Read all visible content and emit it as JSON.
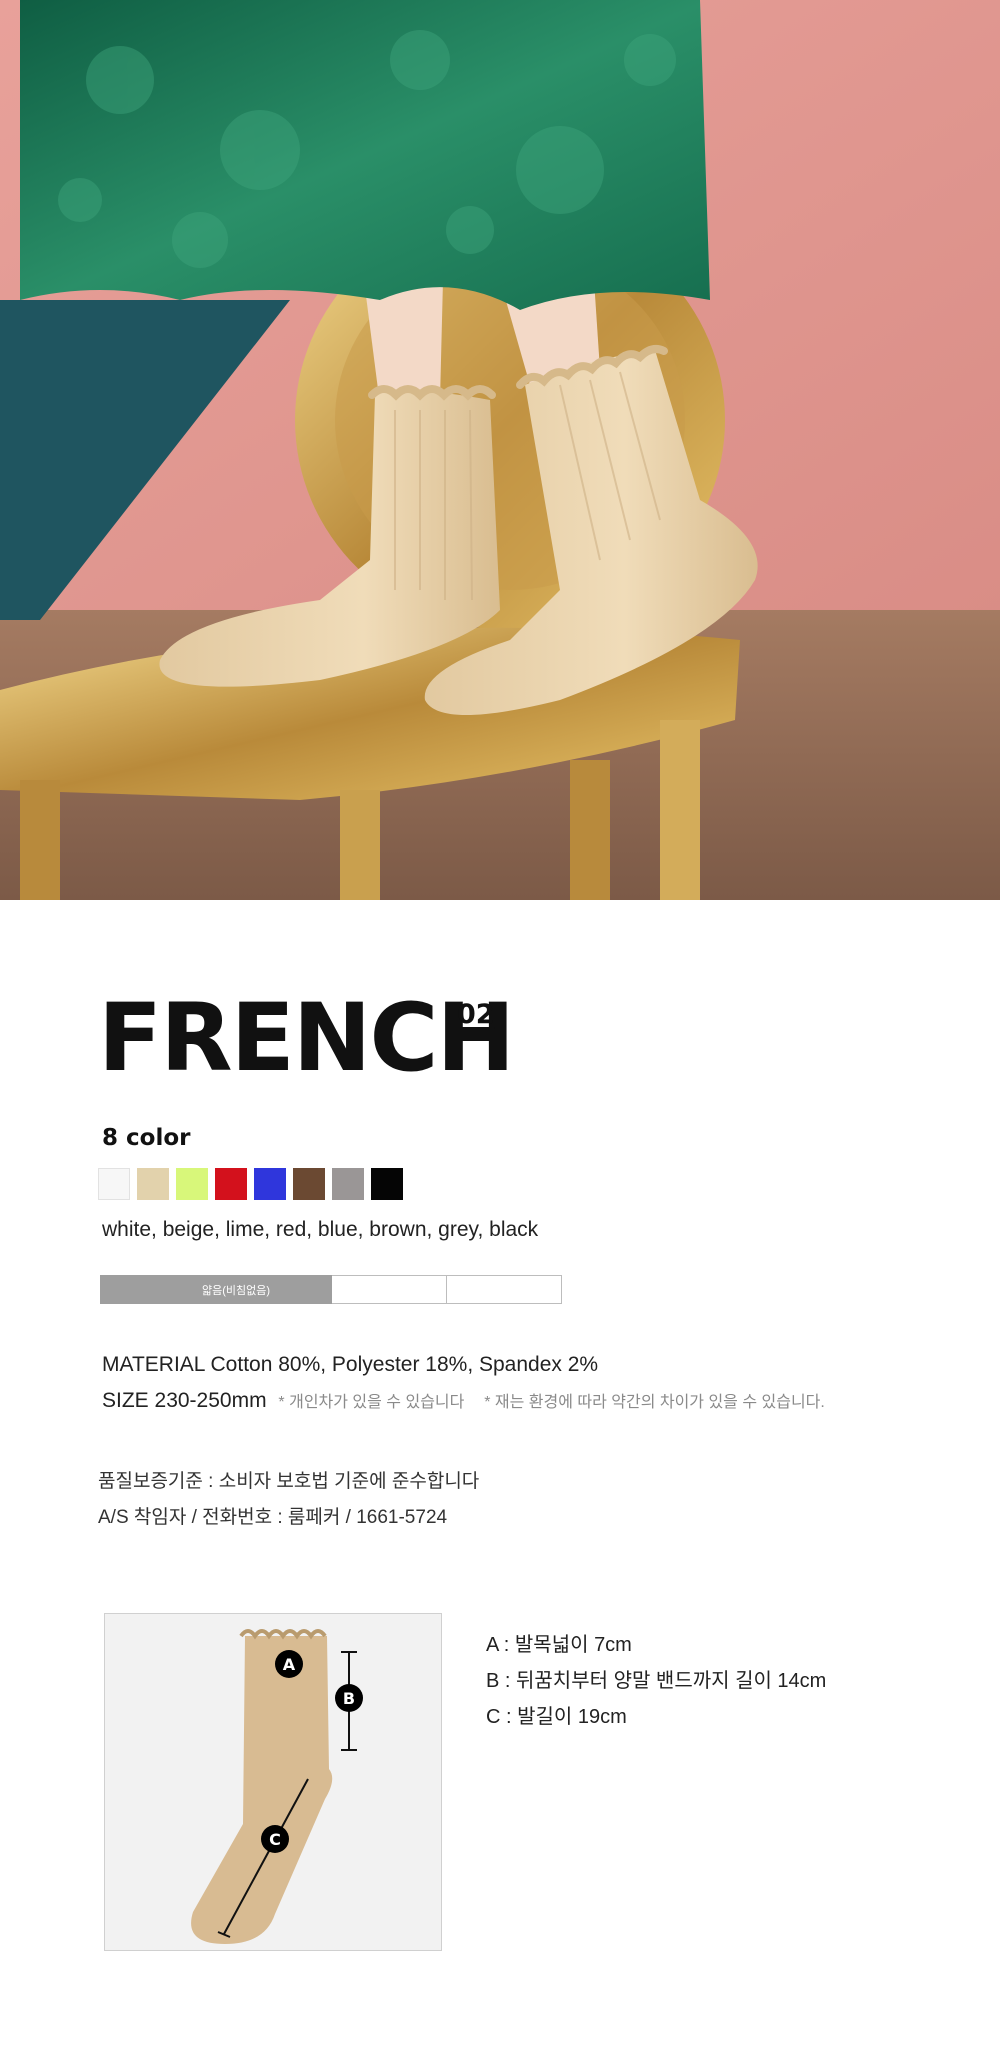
{
  "hero": {
    "colors": {
      "wall": "#e39a91",
      "floor": "#9a6f55",
      "dress": "#1f7a59",
      "sock": "#e9d3ad",
      "chair": "#c9a24f",
      "shadow": "#1f5560"
    }
  },
  "product": {
    "title": "FRENCH",
    "title_number": "02",
    "color_count": "8 color",
    "swatches": [
      {
        "name": "white",
        "hex": "#f7f7f7"
      },
      {
        "name": "beige",
        "hex": "#e2d2ac"
      },
      {
        "name": "lime",
        "hex": "#d8f77a"
      },
      {
        "name": "red",
        "hex": "#d3111c"
      },
      {
        "name": "blue",
        "hex": "#2f36dc"
      },
      {
        "name": "brown",
        "hex": "#6b4932"
      },
      {
        "name": "grey",
        "hex": "#9a9696"
      },
      {
        "name": "black",
        "hex": "#050505"
      }
    ],
    "color_names": "white, beige, lime, red, blue, brown, grey, black",
    "opacity_label": "얇음(비침없음)",
    "material": "MATERIAL  Cotton 80%,  Polyester 18%,  Spandex 2%",
    "size": "SIZE  230-250mm",
    "size_note_1": "* 개인차가 있을 수 있습니다",
    "size_note_2": "* 재는 환경에 따라 약간의 차이가 있을 수 있습니다.",
    "quality_standard": "품질보증기준  : 소비자 보호법 기준에 준수합니다",
    "as_contact": "A/S 착임자 / 전화번호 : 룸페커 / 1661-5724"
  },
  "diagram": {
    "labels": [
      "A",
      "B",
      "C"
    ],
    "measurements": [
      "A : 발목넓이 7cm",
      "B : 뒤꿈치부터 양말 밴드까지 길이 14cm",
      "C : 발길이 19cm"
    ]
  }
}
